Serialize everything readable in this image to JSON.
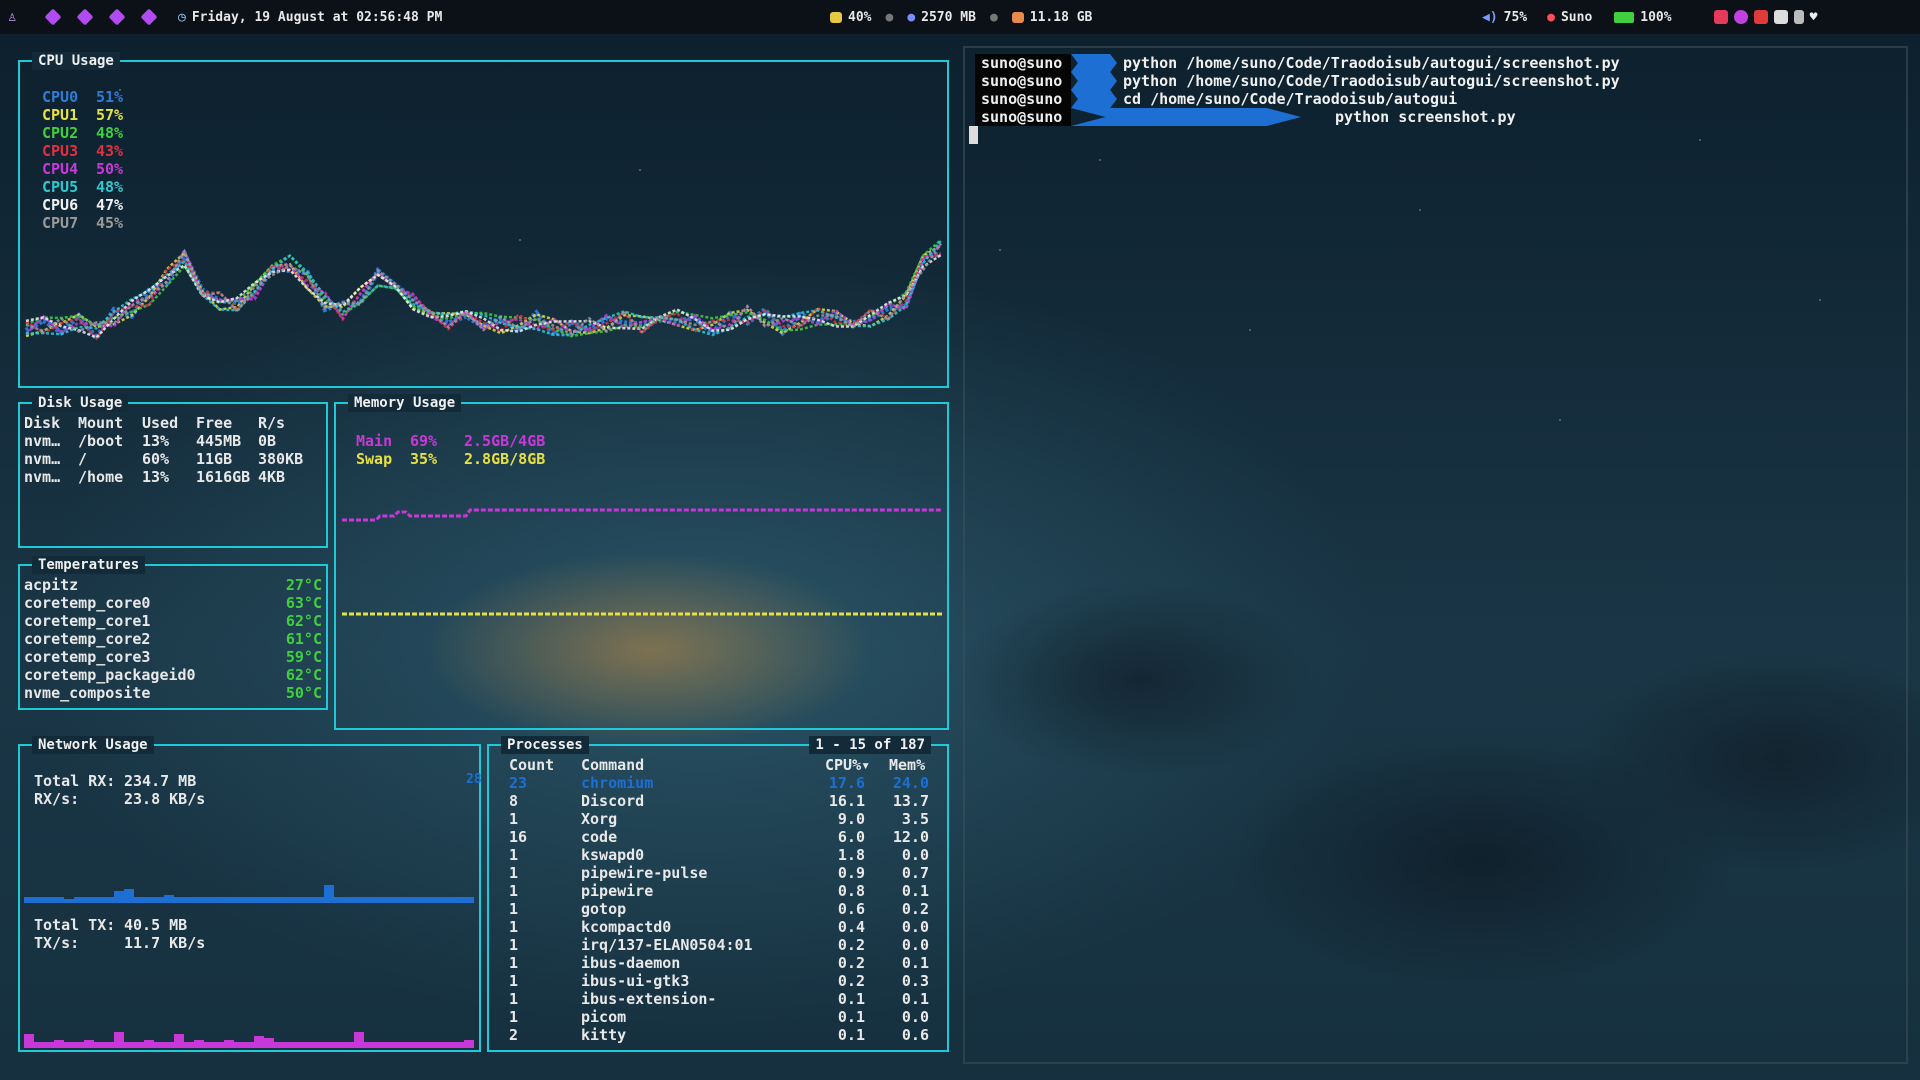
{
  "topbar": {
    "datetime": "Friday, 19 August at 02:56:48 PM",
    "brightness": "40%",
    "ram": "2570 MB",
    "disk": "11.18 GB",
    "volume": "75%",
    "user": "Suno",
    "battery": "100%"
  },
  "cpu": {
    "title": "CPU Usage",
    "cores": [
      {
        "name": "CPU0",
        "value": "51%",
        "color": "#2f7bd8"
      },
      {
        "name": "CPU1",
        "value": "57%",
        "color": "#e6e044"
      },
      {
        "name": "CPU2",
        "value": "48%",
        "color": "#3fcf3f"
      },
      {
        "name": "CPU3",
        "value": "43%",
        "color": "#e03040"
      },
      {
        "name": "CPU4",
        "value": "50%",
        "color": "#c838d8"
      },
      {
        "name": "CPU5",
        "value": "48%",
        "color": "#2fc8d0"
      },
      {
        "name": "CPU6",
        "value": "47%",
        "color": "#f0f0f0"
      },
      {
        "name": "CPU7",
        "value": "45%",
        "color": "#9a9a9a"
      }
    ]
  },
  "disk": {
    "title": "Disk Usage",
    "headers": [
      "Disk",
      "Mount",
      "Used",
      "Free",
      "R/s"
    ],
    "rows": [
      [
        "nvm…",
        "/boot",
        "13%",
        "445MB",
        "0B"
      ],
      [
        "nvm…",
        "/",
        "60%",
        "11GB",
        "380KB"
      ],
      [
        "nvm…",
        "/home",
        "13%",
        "1616GB",
        "4KB"
      ]
    ]
  },
  "memory": {
    "title": "Memory Usage",
    "main_label": "Main",
    "main_pct": "69%",
    "main_amount": "2.5GB/4GB",
    "swap_label": "Swap",
    "swap_pct": "35%",
    "swap_amount": "2.8GB/8GB",
    "main_color": "#c838d8",
    "swap_color": "#e6e044"
  },
  "temperatures": {
    "title": "Temperatures",
    "items": [
      {
        "name": "acpitz",
        "value": "27°C"
      },
      {
        "name": "coretemp_core0",
        "value": "63°C"
      },
      {
        "name": "coretemp_core1",
        "value": "62°C"
      },
      {
        "name": "coretemp_core2",
        "value": "61°C"
      },
      {
        "name": "coretemp_core3",
        "value": "59°C"
      },
      {
        "name": "coretemp_packageid0",
        "value": "62°C"
      },
      {
        "name": "nvme_composite",
        "value": "50°C"
      }
    ]
  },
  "network": {
    "title": "Network Usage",
    "rx_total_label": "Total RX:",
    "rx_total": "234.7 MB",
    "rx_rate_label": "RX/s:",
    "rx_rate": "23.8 KB/s",
    "rx_peak": "28",
    "tx_total_label": "Total TX:",
    "tx_total": "40.5 MB",
    "tx_rate_label": "TX/s:",
    "tx_rate": "11.7 KB/s"
  },
  "processes": {
    "title": "Processes",
    "range": "1 - 15 of 187",
    "headers": [
      "Count",
      "Command",
      "CPU%▾",
      "Mem%"
    ],
    "rows": [
      [
        "23",
        "chromium",
        "17.6",
        "24.0"
      ],
      [
        "8",
        "Discord",
        "16.1",
        "13.7"
      ],
      [
        "1",
        "Xorg",
        "9.0",
        "3.5"
      ],
      [
        "16",
        "code",
        "6.0",
        "12.0"
      ],
      [
        "1",
        "kswapd0",
        "1.8",
        "0.0"
      ],
      [
        "1",
        "pipewire-pulse",
        "0.9",
        "0.7"
      ],
      [
        "1",
        "pipewire",
        "0.8",
        "0.1"
      ],
      [
        "1",
        "gotop",
        "0.6",
        "0.2"
      ],
      [
        "1",
        "kcompactd0",
        "0.4",
        "0.0"
      ],
      [
        "1",
        "irq/137-ELAN0504:01",
        "0.2",
        "0.0"
      ],
      [
        "1",
        "ibus-daemon",
        "0.2",
        "0.1"
      ],
      [
        "1",
        "ibus-ui-gtk3",
        "0.2",
        "0.3"
      ],
      [
        "1",
        "ibus-extension-",
        "0.1",
        "0.1"
      ],
      [
        "1",
        "picom",
        "0.1",
        "0.0"
      ],
      [
        "2",
        "kitty",
        "0.1",
        "0.6"
      ]
    ]
  },
  "terminal": {
    "lines": [
      {
        "user": "suno@suno",
        "command": "python /home/suno/Code/Traodoisub/autogui/screenshot.py"
      },
      {
        "user": "suno@suno",
        "command": "python /home/suno/Code/Traodoisub/autogui/screenshot.py"
      },
      {
        "user": "suno@suno",
        "command": "cd /home/suno/Code/Traodoisub/autogui"
      },
      {
        "user": "suno@suno",
        "command": "python screenshot.py"
      }
    ]
  }
}
